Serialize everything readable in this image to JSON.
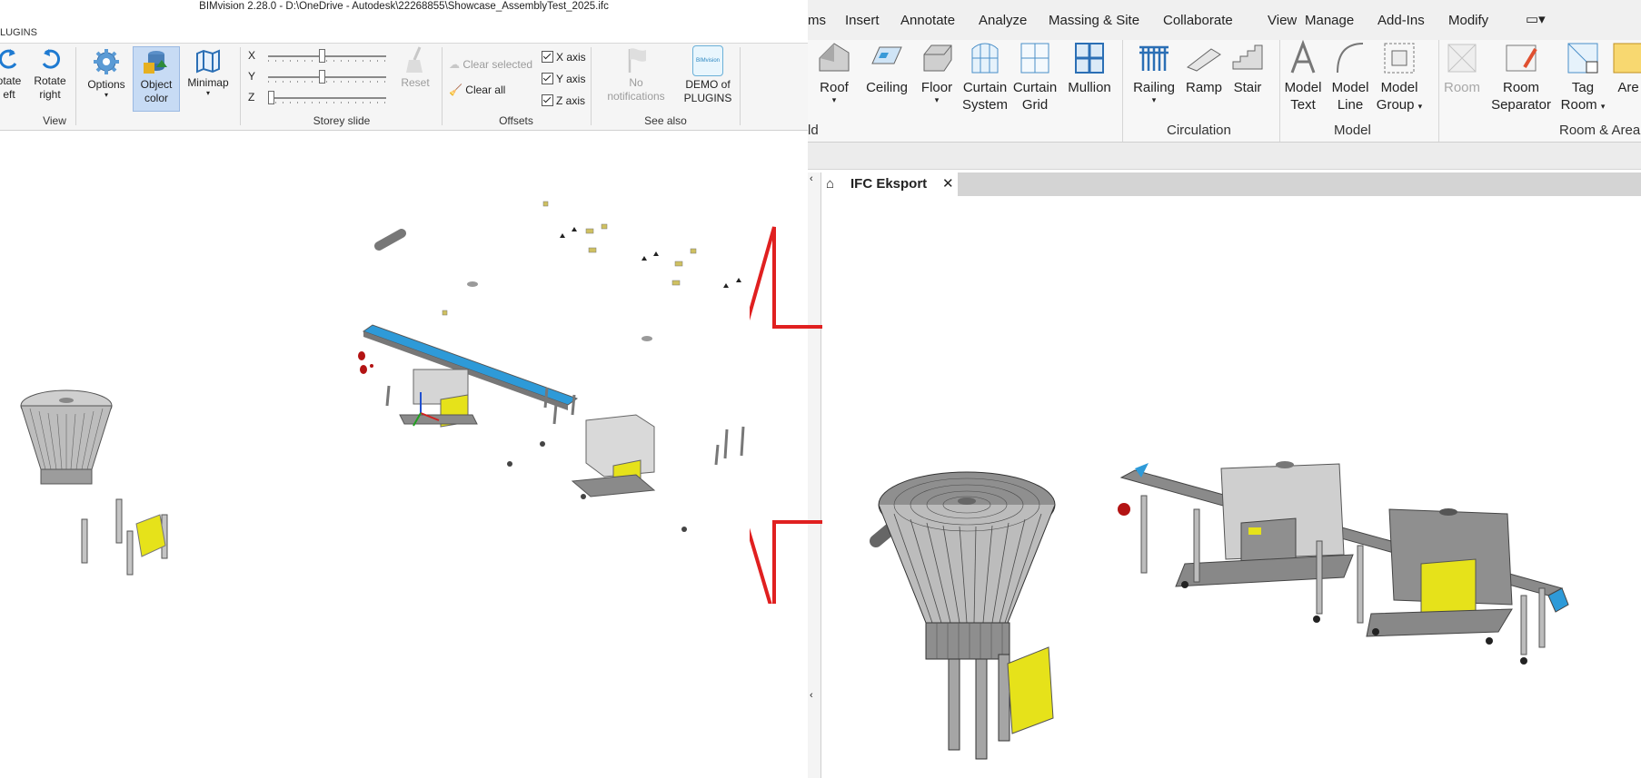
{
  "left_app": {
    "window_title": "BIMvision 2.28.0 - D:\\OneDrive - Autodesk\\22268855\\Showcase_AssemblyTest_2025.ifc",
    "tab_label": "LUGINS",
    "view_group": {
      "label": "View",
      "rotate_left": "otate\neft",
      "rotate_right": "Rotate\nright",
      "options": "Options",
      "object_color": "Object\ncolor",
      "minimap": "Minimap"
    },
    "storey_group": {
      "label": "Storey slide",
      "axes": [
        "X",
        "Y",
        "Z"
      ],
      "levels": [
        0.45,
        0.45,
        0.0
      ],
      "reset": "Reset"
    },
    "offsets_group": {
      "label": "Offsets",
      "clear_selected": "Clear selected",
      "clear_all": "Clear all",
      "x_axis": "X axis",
      "y_axis": "Y axis",
      "z_axis": "Z axis"
    },
    "see_also_group": {
      "label": "See also",
      "notifications": "No\nnotifications",
      "demo": "DEMO of\nPLUGINS",
      "demo_logo_text": "BIMvision"
    }
  },
  "right_app": {
    "menu": [
      "ms",
      "Insert",
      "Annotate",
      "Analyze",
      "Massing & Site",
      "Collaborate",
      "View",
      "Manage",
      "Add-Ins",
      "Modify"
    ],
    "build_tools": [
      "Roof",
      "Ceiling",
      "Floor",
      "Curtain\nSystem",
      "Curtain\nGrid",
      "Mullion"
    ],
    "build_label": "ld",
    "circulation_tools": [
      "Railing",
      "Ramp",
      "Stair"
    ],
    "circulation_label": "Circulation",
    "model_tools": [
      "Model\nText",
      "Model\nLine",
      "Model\nGroup"
    ],
    "model_label": "Model",
    "room_tools": [
      "Room",
      "Room\nSeparator",
      "Tag\nRoom",
      "Are"
    ],
    "room_label": "Room & Area",
    "view_tab_title": "IFC Eksport"
  },
  "colors": {
    "selection_blue": "#c7dbf4",
    "ribbon_bg": "#f5f5f5",
    "arrow_red": "#e02020",
    "equipment_yellow": "#e6e21a",
    "conveyor_blue": "#2e9ad8"
  }
}
